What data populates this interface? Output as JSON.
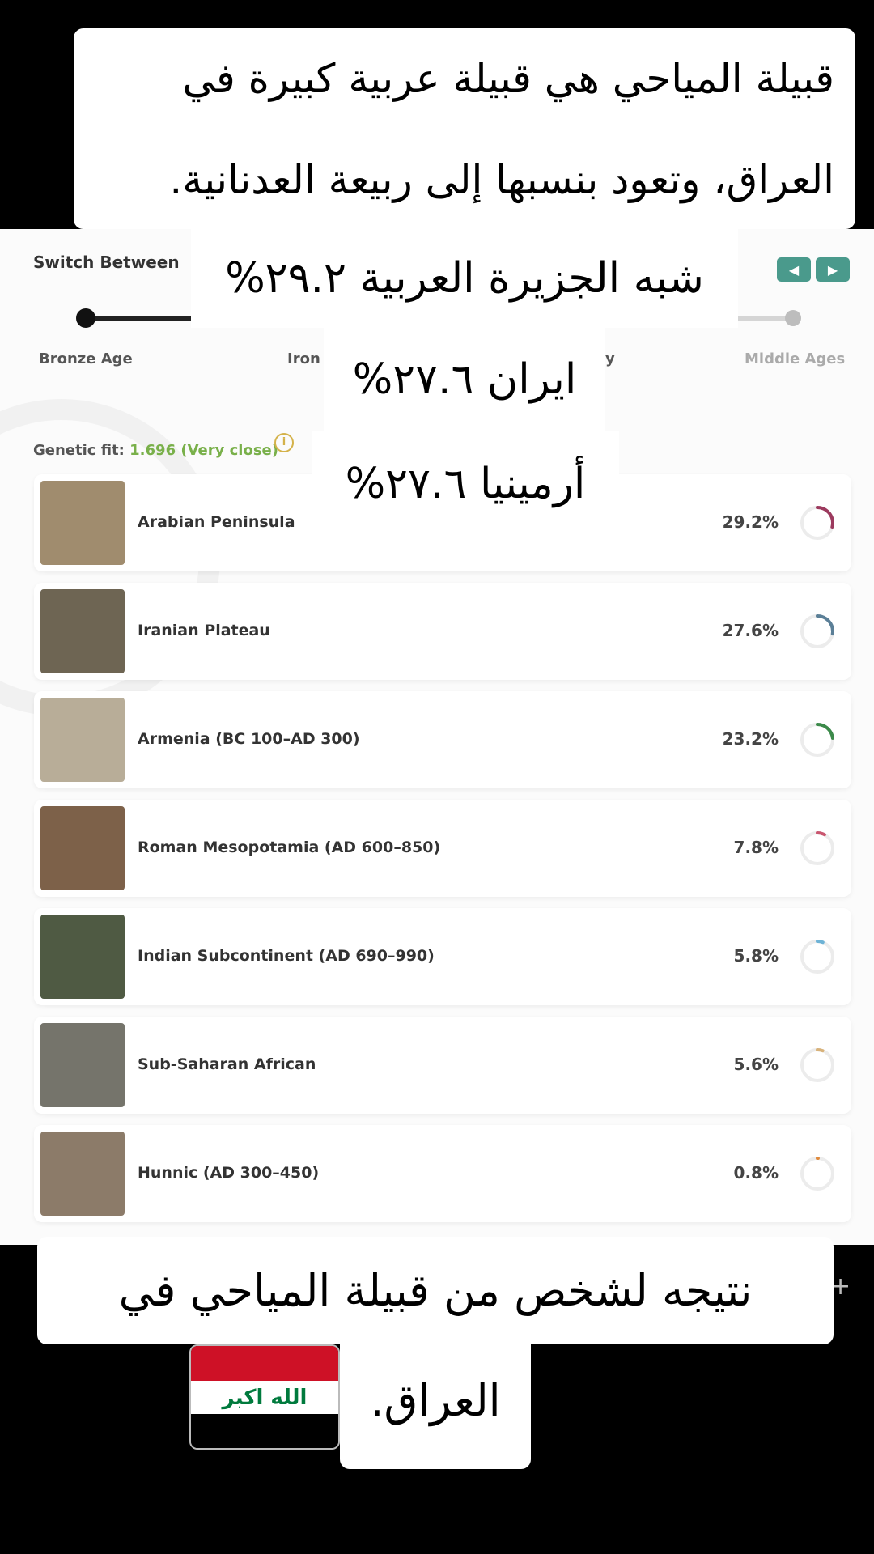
{
  "overlay": {
    "intro": "قبيلة المياحي هي قبيلة عربية كبيرة في العراق، وتعود بنسبها إلى ربيعة العدنانية.",
    "line_arabia": "شبه الجزيرة العربية ٢٩.٢%",
    "line_iran": "ايران ٢٧.٦%",
    "line_armenia": "أرمينيا ٢٧.٦%",
    "result": "نتيجه لشخص من قبيلة المياحي في",
    "country": "العراق.",
    "flag_text": "الله اكبر"
  },
  "panel": {
    "switch_label": "Switch Between",
    "nav_prev": "◀",
    "nav_next": "▶",
    "eras": [
      "Bronze Age",
      "Iron",
      "y",
      "Middle Ages"
    ],
    "genetic_fit_label": "Genetic fit:",
    "genetic_fit_value": "1.696 (Very close)",
    "info": "i"
  },
  "populations": [
    {
      "name": "Arabian Peninsula",
      "percent": "29.2%",
      "value": 29.2,
      "color": "#9c3a5e",
      "thumb": "#a08c6e"
    },
    {
      "name": "Iranian Plateau",
      "percent": "27.6%",
      "value": 27.6,
      "color": "#5b7f97",
      "thumb": "#6e6553"
    },
    {
      "name": "Armenia (BC 100–AD 300)",
      "percent": "23.2%",
      "value": 23.2,
      "color": "#3c8a4a",
      "thumb": "#b8ad98"
    },
    {
      "name": "Roman Mesopotamia (AD 600–850)",
      "percent": "7.8%",
      "value": 7.8,
      "color": "#c9566f",
      "thumb": "#7d6149"
    },
    {
      "name": "Indian Subcontinent (AD 690–990)",
      "percent": "5.8%",
      "value": 5.8,
      "color": "#6eb3d6",
      "thumb": "#4f5a43"
    },
    {
      "name": "Sub-Saharan African",
      "percent": "5.6%",
      "value": 5.6,
      "color": "#d8b27a",
      "thumb": "#75746b"
    },
    {
      "name": "Hunnic (AD 300–450)",
      "percent": "0.8%",
      "value": 0.8,
      "color": "#e08a3c",
      "thumb": "#8c7b69"
    }
  ]
}
